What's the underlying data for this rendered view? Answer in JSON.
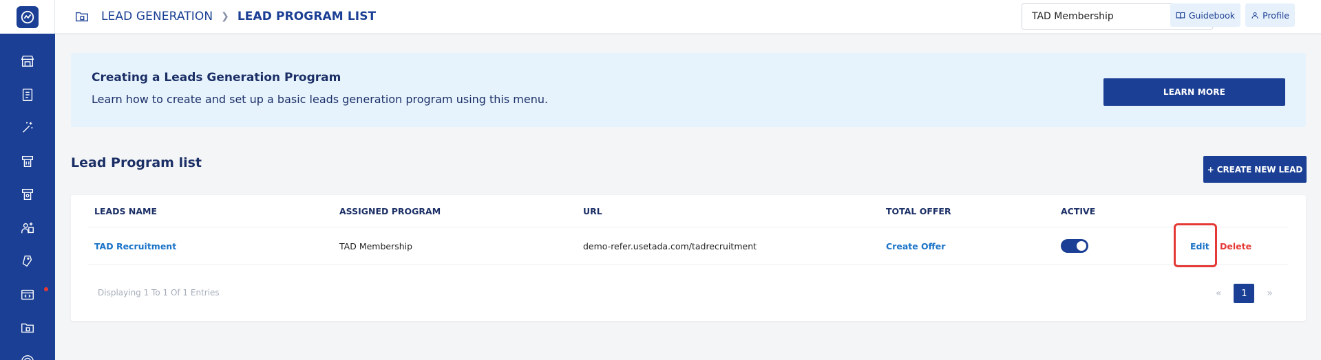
{
  "sidebar": {
    "items": [
      {
        "icon": "storefront-icon"
      },
      {
        "icon": "document-icon"
      },
      {
        "icon": "magic-wand-icon"
      },
      {
        "icon": "ticket-icon"
      },
      {
        "icon": "voucher-icon"
      },
      {
        "icon": "users-icon"
      },
      {
        "icon": "tag-icon"
      },
      {
        "icon": "code-window-icon",
        "has_notification": true
      },
      {
        "icon": "folder-icon"
      },
      {
        "icon": "target-icon"
      }
    ]
  },
  "header": {
    "breadcrumbs": [
      "LEAD GENERATION",
      "LEAD PROGRAM LIST"
    ],
    "program_select": {
      "selected": "TAD Membership"
    },
    "guidebook_label": "Guidebook",
    "profile_label": "Profile"
  },
  "banner": {
    "title": "Creating a Leads Generation Program",
    "text": "Learn how to create and set up a basic leads generation program using this menu.",
    "button_label": "LEARN MORE"
  },
  "section": {
    "title": "Lead Program list",
    "create_button_label": "+ CREATE NEW LEAD"
  },
  "table": {
    "columns": [
      "LEADS NAME",
      "ASSIGNED PROGRAM",
      "URL",
      "TOTAL OFFER",
      "ACTIVE"
    ],
    "rows": [
      {
        "name": "TAD Recruitment",
        "program": "TAD Membership",
        "url": "demo-refer.usetada.com/tadrecruitment",
        "total_offer": "Create Offer",
        "active": true,
        "edit_label": "Edit",
        "delete_label": "Delete"
      }
    ],
    "entries_text": "Displaying 1 To 1 Of 1 Entries",
    "pagination": {
      "prev": "«",
      "current": "1",
      "next": "»"
    }
  },
  "colors": {
    "primary": "#1b3f94",
    "link": "#1a73c8",
    "danger": "#e53935",
    "banner_bg": "#e6f3fd"
  }
}
